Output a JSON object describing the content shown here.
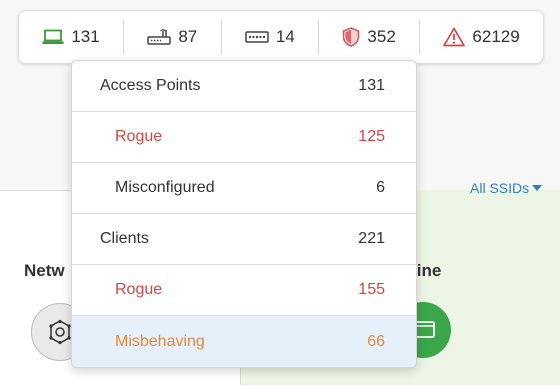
{
  "statusbar": {
    "items": [
      {
        "icon": "laptop-icon",
        "value": "131"
      },
      {
        "icon": "router-icon",
        "value": "87"
      },
      {
        "icon": "switch-icon",
        "value": "14"
      },
      {
        "icon": "shield-icon",
        "value": "352"
      },
      {
        "icon": "warning-icon",
        "value": "62129"
      }
    ]
  },
  "background": {
    "ssid_filter": "All SSIDs",
    "left_title": "Netw",
    "right_title": "line"
  },
  "dropdown": {
    "rows": [
      {
        "label": "Access Points",
        "count": "131"
      },
      {
        "label": "Rogue",
        "count": "125"
      },
      {
        "label": "Misconfigured",
        "count": "6"
      },
      {
        "label": "Clients",
        "count": "221"
      },
      {
        "label": "Rogue",
        "count": "155"
      },
      {
        "label": "Misbehaving",
        "count": "66"
      }
    ]
  },
  "colors": {
    "rogue": "#d64545",
    "misbehaving": "#e98a3b",
    "highlight": "#e6f0fa",
    "link": "#2c7fc4",
    "laptop": "#3a9a3a",
    "warning": "#d64545"
  }
}
